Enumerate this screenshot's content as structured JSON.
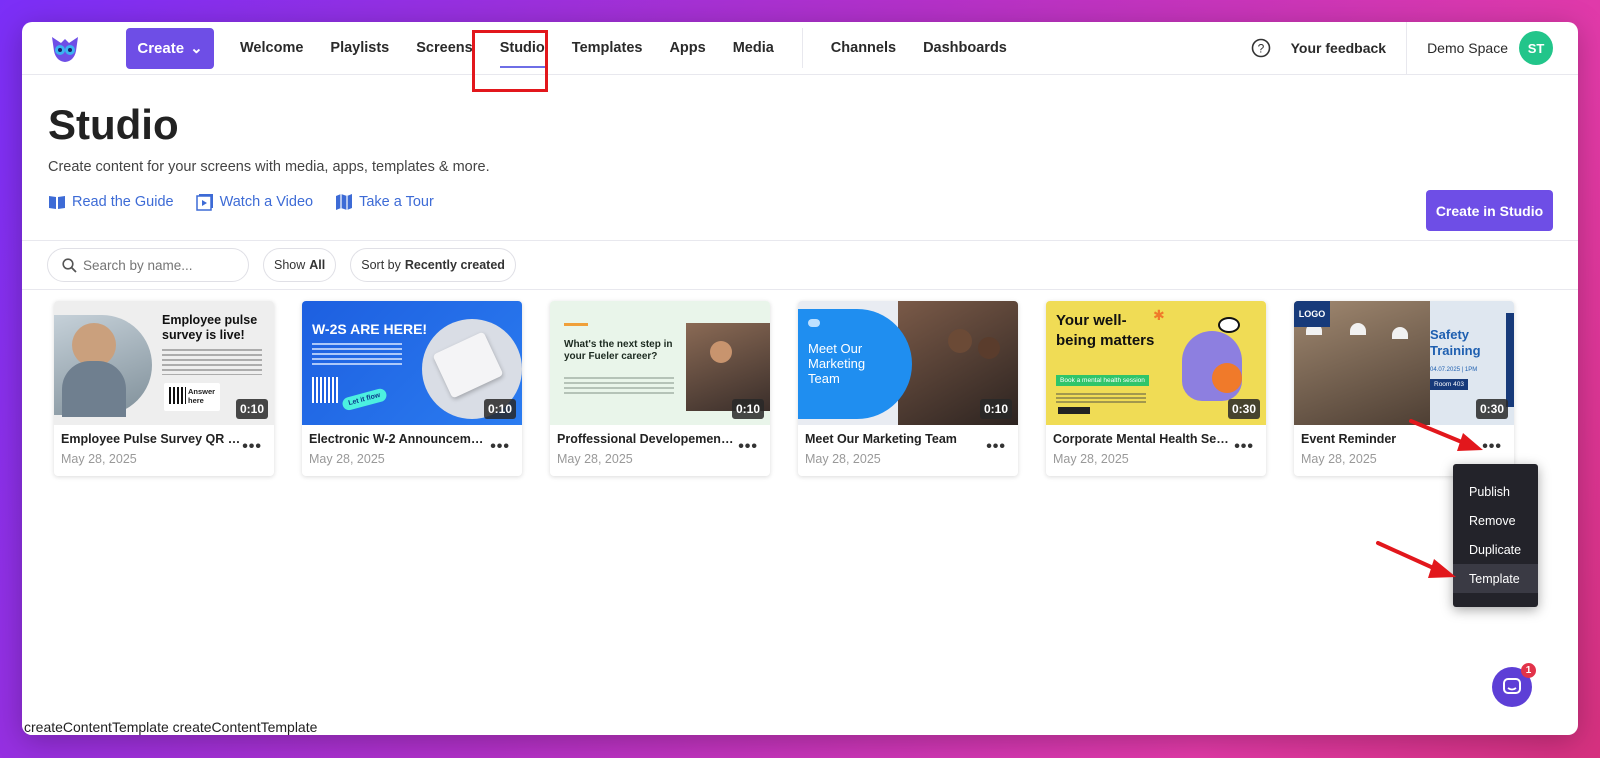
{
  "nav": {
    "create_label": "Create",
    "items": [
      "Welcome",
      "Playlists",
      "Screens",
      "Studio",
      "Templates",
      "Apps",
      "Media"
    ],
    "items2": [
      "Channels",
      "Dashboards"
    ],
    "feedback": "Your feedback",
    "space": "Demo Space",
    "avatar": "ST"
  },
  "header": {
    "title": "Studio",
    "subtitle": "Create content for your screens with media, apps, templates & more.",
    "links": [
      "Read the Guide",
      "Watch a Video",
      "Take a Tour"
    ],
    "cta": "Create in Studio"
  },
  "filters": {
    "search_placeholder": "Search by name...",
    "show_prefix": "Show",
    "show_value": "All",
    "sort_prefix": "Sort by",
    "sort_value": "Recently created"
  },
  "cards": [
    {
      "title": "Employee Pulse Survey QR Co...",
      "date": "May 28, 2025",
      "duration": "0:10",
      "thumb_text": "Employee pulse survey is live!",
      "thumb_btn": "Answer here"
    },
    {
      "title": "Electronic W-2 Announcement",
      "date": "May 28, 2025",
      "duration": "0:10",
      "thumb_text": "W-2S ARE HERE!",
      "thumb_btn": "Let it flow"
    },
    {
      "title": "Proffessional Developement O...",
      "date": "May 28, 2025",
      "duration": "0:10",
      "thumb_text": "What's the next step in your Fueler career?"
    },
    {
      "title": "Meet Our Marketing Team",
      "date": "May 28, 2025",
      "duration": "0:10",
      "thumb_text": "Meet Our Marketing Team"
    },
    {
      "title": "Corporate Mental Health Sessi...",
      "date": "May 28, 2025",
      "duration": "0:30",
      "thumb_text": "Your well-being matters",
      "thumb_btn": "Book a mental health session"
    },
    {
      "title": "Event Reminder",
      "date": "May 28, 2025",
      "duration": "0:30",
      "thumb_text": "Safety Training",
      "thumb_date": "04.07.2025 | 1PM",
      "thumb_room": "Room 403",
      "thumb_logo": "LOGO"
    }
  ],
  "menu": [
    "Publish",
    "Remove",
    "Duplicate",
    "Template"
  ],
  "status_bar": "createContentTemplate createContentTemplate",
  "chat_badge": "1",
  "colors": {
    "brand": "#6e4ee6",
    "link": "#3d6bd6",
    "avatar": "#22c58a",
    "highlight": "#e2171c"
  }
}
